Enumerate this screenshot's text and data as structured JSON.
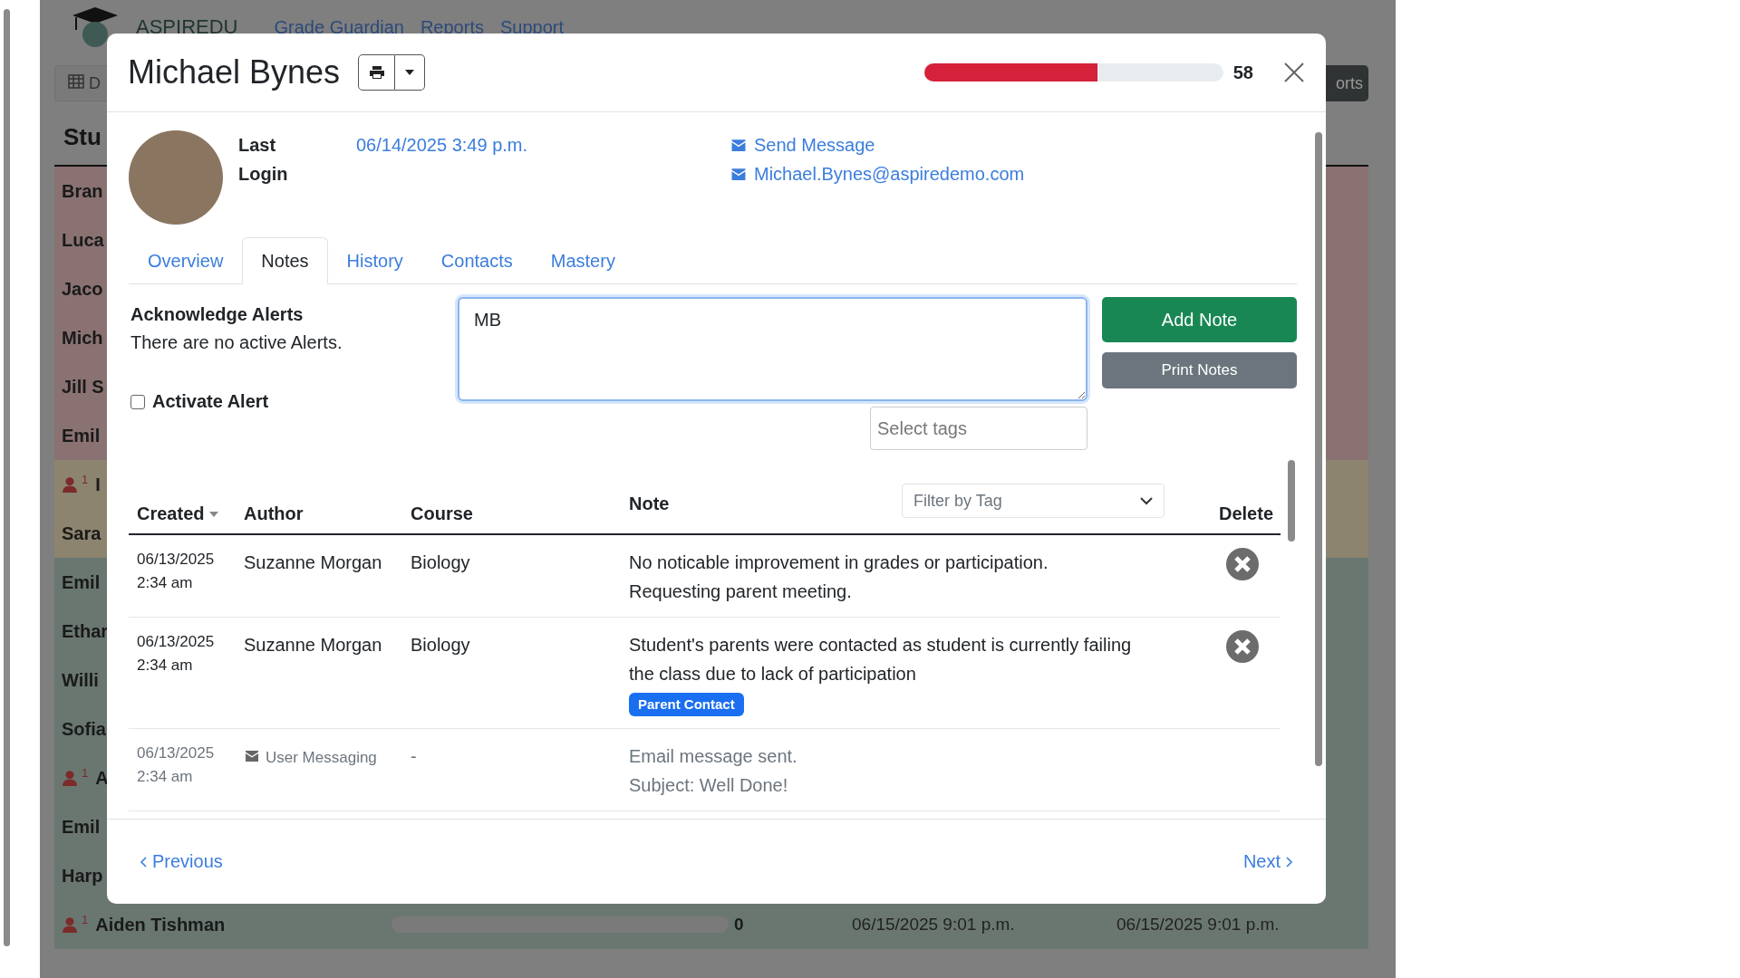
{
  "background_page": {
    "logo_text": "ASPIREDU",
    "nav_links": [
      "Grade Guardian",
      "Reports",
      "Support"
    ],
    "toolbar_left_label": "D",
    "toolbar_right_label": "orts",
    "heading": "Stu",
    "rows": [
      {
        "name": "Bran",
        "color": "#8a7272"
      },
      {
        "name": "Luca",
        "color": "#8a7272"
      },
      {
        "name": "Jaco",
        "color": "#8a7272"
      },
      {
        "name": "Mich",
        "color": "#8a7272"
      },
      {
        "name": "Jill S",
        "color": "#8a7272"
      },
      {
        "name": "Emil",
        "color": "#8a7272"
      },
      {
        "name": "I",
        "color": "#8c846e",
        "alert_count": "1"
      },
      {
        "name": "Sara",
        "color": "#8c846e"
      },
      {
        "name": "Emil",
        "color": "#6a7770"
      },
      {
        "name": "Ethar",
        "color": "#6a7770"
      },
      {
        "name": "Willi",
        "color": "#6a7770"
      },
      {
        "name": "Sofia",
        "color": "#6a7770"
      },
      {
        "name": "A",
        "color": "#6a7770",
        "alert_count": "1"
      },
      {
        "name": "Emil",
        "color": "#6a7770"
      },
      {
        "name": "Harp",
        "color": "#6a7770"
      },
      {
        "name": "Aiden Tishman",
        "color": "#6a7770",
        "alert_count": "1",
        "level": 0,
        "score": "0",
        "date_1": "06/15/2025 9:01 p.m.",
        "date_2": "06/15/2025 9:01 p.m."
      }
    ]
  },
  "dialog": {
    "title": "Michael Bynes",
    "progress": {
      "level": 0.58,
      "value": "58"
    },
    "last_login_label": "Last Login",
    "last_login": "06/14/2025 3:49 p.m.",
    "contact_links": [
      "Send Message",
      "Michael.Bynes@aspiredemo.com"
    ],
    "tabs": [
      {
        "label": "Overview",
        "selected": false
      },
      {
        "label": "Notes",
        "selected": true
      },
      {
        "label": "History",
        "selected": false
      },
      {
        "label": "Contacts",
        "selected": false
      },
      {
        "label": "Mastery",
        "selected": false
      }
    ],
    "alerts_title": "Acknowledge Alerts",
    "alerts_text": "There are no active Alerts.",
    "activate_alert": {
      "label": "Activate Alert",
      "checked": false
    },
    "note_input": {
      "value": "MB "
    },
    "buttons": {
      "add_note": "Add Note",
      "print_notes": "Print Notes"
    },
    "tags_field": {
      "placeholder": "Select tags"
    },
    "table": {
      "columns": [
        "Created",
        "Author",
        "Course",
        "Note",
        "Delete"
      ],
      "filter": {
        "placeholder": "Filter by Tag"
      },
      "rows": [
        {
          "kind": "note",
          "date": "06/13/2025",
          "time": "2:34 am",
          "author": "Suzanne Morgan",
          "course": "Biology",
          "note": "No noticable improvement in grades or participation. Requesting parent meeting."
        },
        {
          "kind": "note",
          "date": "06/13/2025",
          "time": "2:34 am",
          "author": "Suzanne Morgan",
          "course": "Biology",
          "note": "Student's parents were contacted as student is currently failing the class due to lack of participation",
          "tags": [
            "Parent Contact"
          ]
        },
        {
          "kind": "message",
          "date": "06/13/2025",
          "time": "2:34 am",
          "author": "User Messaging",
          "course": "-",
          "note": "Email message sent.\nSubject: Well Done!"
        }
      ]
    },
    "footer": {
      "previous": "Previous",
      "next": "Next"
    }
  }
}
